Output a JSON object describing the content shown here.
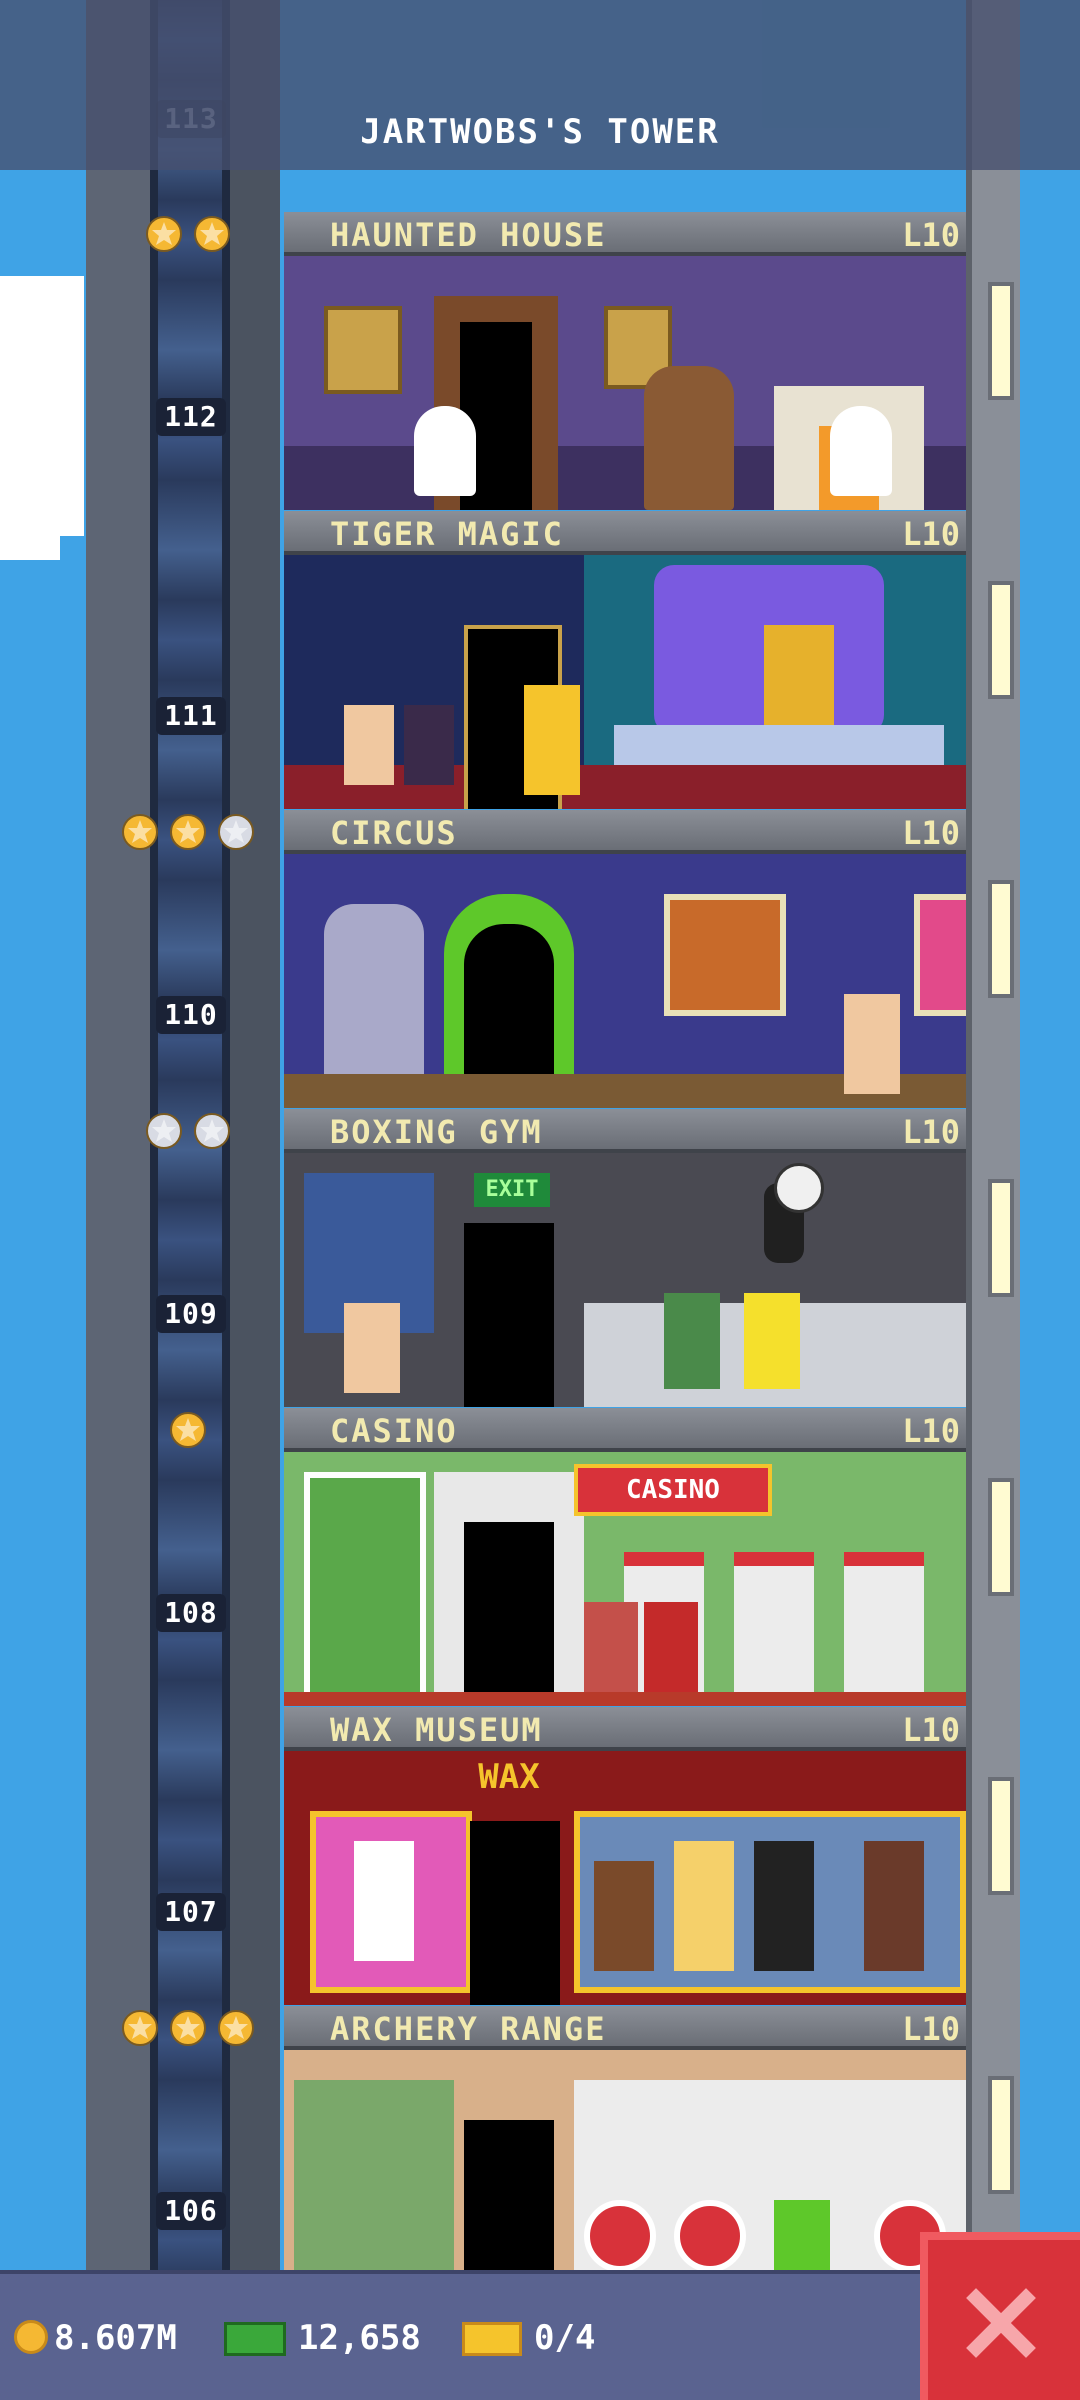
{
  "header": {
    "title": "JARTWOBS'S TOWER",
    "partial_floor_number": "113"
  },
  "floors": [
    {
      "name": "HAUNTED HOUSE",
      "level": "L10",
      "number": "112",
      "stars": [
        "gold",
        "gold"
      ]
    },
    {
      "name": "TIGER MAGIC",
      "level": "L10",
      "number": "111",
      "stars": []
    },
    {
      "name": "CIRCUS",
      "level": "L10",
      "number": "110",
      "stars": [
        "gold",
        "gold",
        "silver"
      ]
    },
    {
      "name": "BOXING GYM",
      "level": "L10",
      "number": "109",
      "stars": [
        "silver",
        "silver"
      ]
    },
    {
      "name": "CASINO",
      "level": "L10",
      "number": "108",
      "stars": [
        "gold"
      ],
      "sign": "CASINO"
    },
    {
      "name": "WAX MUSEUM",
      "level": "L10",
      "number": "107",
      "stars": [],
      "sign": "WAX"
    },
    {
      "name": "ARCHERY RANGE",
      "level": "L10",
      "number": "106",
      "stars": [
        "gold",
        "gold",
        "gold"
      ]
    }
  ],
  "boxing_gym_sign": "EXIT",
  "status_bar": {
    "coins": "8.607M",
    "bux": "12,658",
    "tickets": "0/4"
  },
  "colors": {
    "sky": "#3fa3e6",
    "gold_star": "#f5b833",
    "silver_star": "#d8dbe4",
    "close_button": "#d8323a",
    "label_text": "#f2eab0"
  },
  "icons": {
    "close": "close-icon",
    "coin": "coin-icon",
    "bux": "bux-icon",
    "ticket": "ticket-icon",
    "star": "star-icon"
  }
}
